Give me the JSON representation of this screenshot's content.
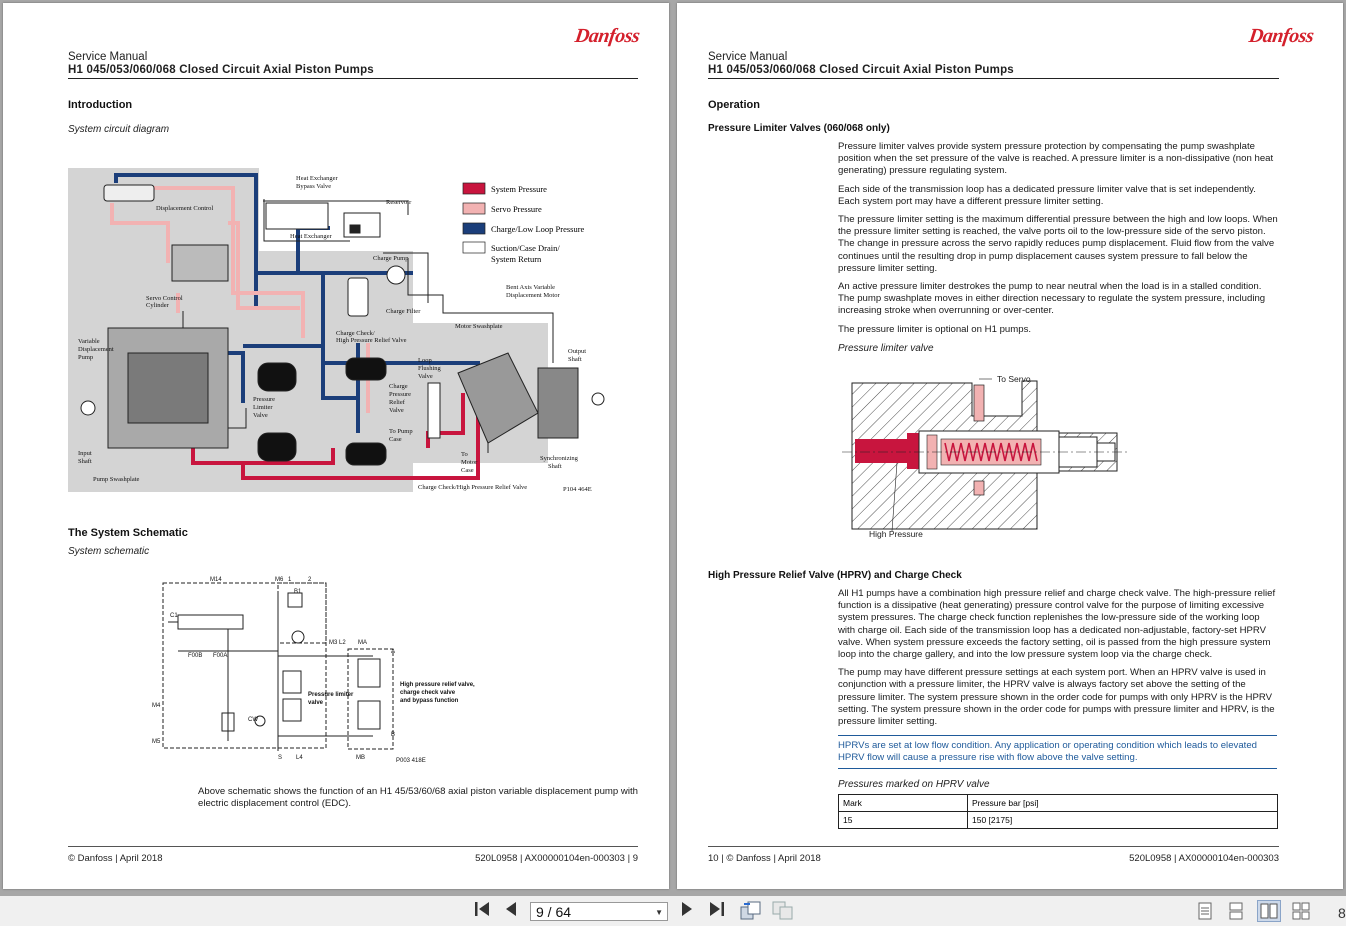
{
  "header": {
    "title": "Service Manual",
    "subtitle": "H1 045/053/060/068 Closed Circuit Axial Piston Pumps",
    "logo": "Danfoss"
  },
  "left": {
    "intro_heading": "Introduction",
    "diagram_caption": "System circuit diagram",
    "legend": [
      "System Pressure",
      "Servo Pressure",
      "Charge/Low Loop Pressure",
      "Suction/Case Drain/",
      "System Return"
    ],
    "labels": {
      "heat_exchanger_bypass": "Heat Exchanger",
      "bypass2": "Bypass Valve",
      "displacement_control": "Displacement Control",
      "reservoir": "Reservoir",
      "heat_exchanger": "Heat Exchanger",
      "charge_pump": "Charge Pump",
      "charge_filter": "Charge Filter",
      "servo_control": "Servo Control",
      "cylinder": "Cylinder",
      "bent_axis": "Bent Axis Variable",
      "displacement_motor": "Displacement Motor",
      "charge_check_1": "Charge Check/",
      "charge_check_2": "High Pressure Relief Valve",
      "motor_swashplate": "Motor Swashplate",
      "variable": "Variable",
      "displacement": "Displacement",
      "pump": "Pump",
      "output": "Output",
      "shaft": "Shaft",
      "loop": "Loop",
      "flushing": "Flushing",
      "valve": "Valve",
      "pressure": "Pressure",
      "limiter": "Limiter",
      "charge": "Charge",
      "relief": "Relief",
      "to_pump": "To Pump",
      "case": "Case",
      "to": "To",
      "motor": "Motor",
      "input": "Input",
      "pump_swashplate": "Pump Swashplate",
      "synchronizing": "Synchronizing",
      "charge_check_bottom": "Charge Check/High Pressure Relief Valve",
      "code": "P104 464E"
    },
    "schematic_heading": "The System Schematic",
    "schematic_caption": "System schematic",
    "schem_labels": {
      "m14": "M14",
      "m6": "M6",
      "one": "1",
      "two": "2",
      "c1": "C1",
      "b1": "B1",
      "f00b": "F00B",
      "f00a": "F00A",
      "m3l2": "M3 L2",
      "ma": "MA",
      "a": "A",
      "m4": "M4",
      "cw": "CW",
      "m5": "M5",
      "b": "B",
      "s": "S",
      "l4": "L4",
      "mb": "MB",
      "code": "P003 418E",
      "hprv1": "High pressure relief valve,",
      "hprv2": "charge check valve",
      "hprv3": "and bypass function",
      "pl1": "Pressure limiter",
      "pl2": "valve"
    },
    "schematic_text": "Above schematic shows the function of an H1 45/53/60/68 axial piston variable displacement pump with electric displacement control (EDC).",
    "footer_left": "© Danfoss | April 2018",
    "footer_right": "520L0958 | AX00000104en-000303 | 9"
  },
  "right": {
    "op_heading": "Operation",
    "plv_heading": "Pressure Limiter Valves (060/068 only)",
    "plv_paragraphs": [
      "Pressure limiter valves provide system pressure protection by compensating the pump swashplate position when the set pressure of the valve is reached. A pressure limiter is a non-dissipative (non heat generating) pressure regulating system.",
      "Each side of the transmission loop has a dedicated pressure limiter valve that is set independently. Each system port may have a different pressure limiter setting.",
      "The pressure limiter setting is the maximum differential pressure between the high and low loops. When the pressure limiter setting is reached, the valve ports oil to the low-pressure side of the servo piston. The change in pressure across the servo rapidly reduces pump displacement. Fluid flow from the valve continues until the resulting drop in pump displacement causes system pressure to fall below the pressure limiter setting.",
      "An active pressure limiter destrokes the pump to near neutral when the load is in a stalled condition. The pump swashplate moves in either direction necessary to regulate the system pressure, including increasing stroke when overrunning or over-center.",
      "The pressure limiter is optional on H1 pumps."
    ],
    "plv_caption": "Pressure limiter valve",
    "to_servo": "To Servo",
    "high_pressure": "High Pressure",
    "hprv_heading": "High Pressure Relief Valve (HPRV) and Charge Check",
    "hprv_paragraphs": [
      "All H1 pumps have a combination high pressure relief and charge check valve. The high-pressure relief function is a dissipative (heat generating) pressure control valve for the purpose of limiting excessive system pressures. The charge check function replenishes the low-pressure side of the working loop with charge oil. Each side of the transmission loop has a dedicated non-adjustable, factory-set HPRV valve. When system pressure exceeds the factory setting, oil is passed from the high pressure system loop into the charge gallery, and into the low pressure system loop via the charge check.",
      "The pump may have different pressure settings at each system port. When an HPRV valve is used in conjunction with a pressure limiter, the HPRV valve is always factory set above the setting of the pressure limiter. The system pressure shown in the order code for pumps with only HPRV is the HPRV setting. The system pressure shown in the order code for pumps with pressure limiter and HPRV, is the pressure limiter setting."
    ],
    "note": "HPRVs are set at low flow condition. Any application or operating condition which leads to elevated HPRV flow will cause a pressure rise with flow above the valve setting.",
    "table_caption": "Pressures marked on HPRV valve",
    "table_headers": [
      "Mark",
      "Pressure bar [psi]"
    ],
    "table_rows": [
      [
        "15",
        "150 [2175]"
      ]
    ],
    "footer_left": "10 | © Danfoss | April 2018",
    "footer_right": "520L0958 | AX00000104en-000303"
  },
  "toolbar": {
    "page_value": "9 / 64",
    "zoom": "8"
  },
  "colors": {
    "system": "#c8153e",
    "servo": "#f2b2b2",
    "charge": "#1b3e7a",
    "suction": "#ffffff"
  }
}
